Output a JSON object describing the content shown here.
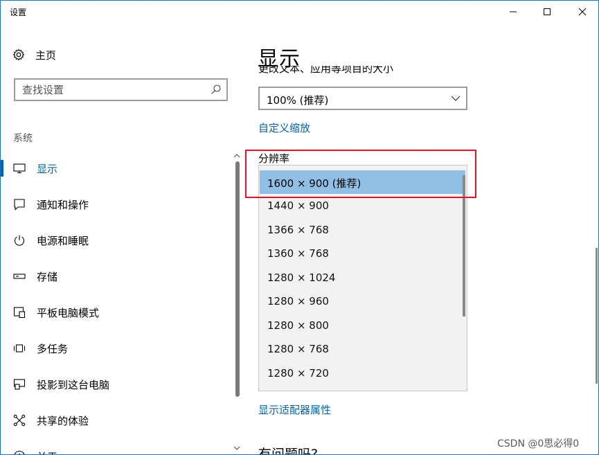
{
  "window": {
    "title": "设置",
    "controls": {
      "minimize": "minimize-icon",
      "maximize": "maximize-icon",
      "close": "close-icon"
    }
  },
  "sidebar": {
    "home_label": "主页",
    "search_placeholder": "查找设置",
    "section_label": "系统",
    "items": [
      {
        "label": "显示",
        "icon": "monitor-icon",
        "active": true
      },
      {
        "label": "通知和操作",
        "icon": "message-icon",
        "active": false
      },
      {
        "label": "电源和睡眠",
        "icon": "power-icon",
        "active": false
      },
      {
        "label": "存储",
        "icon": "storage-icon",
        "active": false
      },
      {
        "label": "平板电脑模式",
        "icon": "tablet-mode-icon",
        "active": false
      },
      {
        "label": "多任务",
        "icon": "multitask-icon",
        "active": false
      },
      {
        "label": "投影到这台电脑",
        "icon": "project-icon",
        "active": false
      },
      {
        "label": "共享的体验",
        "icon": "share-icon",
        "active": false
      },
      {
        "label": "关于",
        "icon": "info-icon",
        "active": false
      }
    ]
  },
  "main": {
    "title": "显示",
    "scale_label": "更改文本、应用等项目的大小",
    "scale_value": "100% (推荐)",
    "custom_scale_link": "自定义缩放",
    "resolution_label": "分辨率",
    "resolutions": [
      {
        "label": "1600 × 900 (推荐)",
        "selected": true
      },
      {
        "label": "1440 × 900",
        "selected": false
      },
      {
        "label": "1366 × 768",
        "selected": false
      },
      {
        "label": "1360 × 768",
        "selected": false
      },
      {
        "label": "1280 × 1024",
        "selected": false
      },
      {
        "label": "1280 × 960",
        "selected": false
      },
      {
        "label": "1280 × 800",
        "selected": false
      },
      {
        "label": "1280 × 768",
        "selected": false
      },
      {
        "label": "1280 × 720",
        "selected": false
      }
    ],
    "adapter_link": "显示适配器属性",
    "question_heading": "有问题吗?"
  },
  "colors": {
    "accent": "#0063b1",
    "selection": "#90bfe6",
    "highlight_border": "#e81123",
    "window_border": "#1a73c9"
  },
  "watermark": "CSDN @0思必得0"
}
